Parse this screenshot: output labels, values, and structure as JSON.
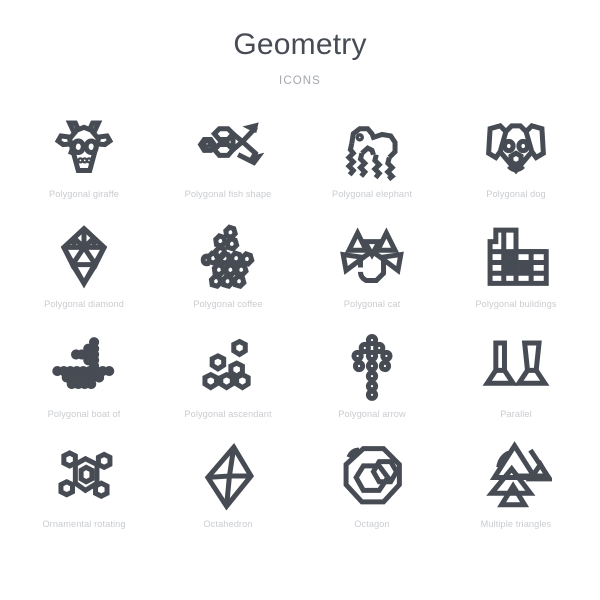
{
  "header": {
    "title": "geometry",
    "subtitle": "icons"
  },
  "colors": {
    "background": "#ffffff",
    "title": "#474c54",
    "subtitle": "#a3a7ad",
    "icon_stroke": "#474c54",
    "label": "#c9ccd0"
  },
  "grid": {
    "columns": 4,
    "rows": 4,
    "items": [
      {
        "label": "Polygonal giraffe",
        "icon": "polygonal-giraffe-icon"
      },
      {
        "label": "Polygonal fish shape",
        "icon": "polygonal-fish-shape-icon"
      },
      {
        "label": "Polygonal elephant",
        "icon": "polygonal-elephant-icon"
      },
      {
        "label": "Polygonal dog",
        "icon": "polygonal-dog-icon"
      },
      {
        "label": "Polygonal diamond",
        "icon": "polygonal-diamond-icon"
      },
      {
        "label": "Polygonal coffee",
        "icon": "polygonal-coffee-icon"
      },
      {
        "label": "Polygonal cat",
        "icon": "polygonal-cat-icon"
      },
      {
        "label": "Polygonal buildings",
        "icon": "polygonal-buildings-icon"
      },
      {
        "label": "Polygonal boat of",
        "icon": "polygonal-boat-icon"
      },
      {
        "label": "Polygonal ascendant",
        "icon": "polygonal-ascendant-icon"
      },
      {
        "label": "Polygonal arrow",
        "icon": "polygonal-arrow-icon"
      },
      {
        "label": "Parallel",
        "icon": "parallel-icon"
      },
      {
        "label": "Ornamental rotating",
        "icon": "ornamental-rotating-icon"
      },
      {
        "label": "Octahedron",
        "icon": "octahedron-icon"
      },
      {
        "label": "Octagon",
        "icon": "octagon-icon"
      },
      {
        "label": "Multiple triangles",
        "icon": "multiple-triangles-icon"
      }
    ]
  }
}
